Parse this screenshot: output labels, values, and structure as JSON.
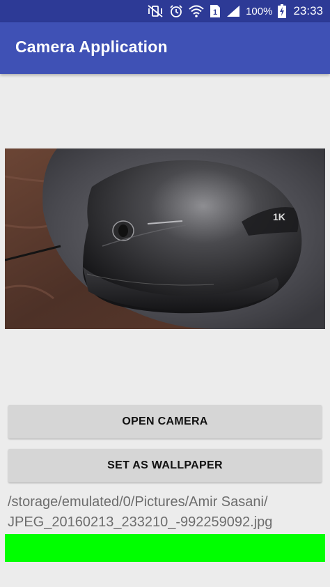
{
  "status_bar": {
    "battery_percent": "100%",
    "time": "23:33",
    "sim_slot": "1",
    "icons": [
      "mute-vibrate-icon",
      "alarm-icon",
      "wifi-icon",
      "sim-icon",
      "signal-icon",
      "battery-charging-icon"
    ]
  },
  "app_bar": {
    "title": "Camera Application",
    "color": "#3f51b5",
    "status_color": "#2d3a96"
  },
  "image": {
    "description_name": "captured-photo-mouse",
    "logo_text": "1K"
  },
  "buttons": {
    "open_camera": "OPEN CAMERA",
    "set_wallpaper": "SET AS WALLPAPER"
  },
  "file_path": {
    "line1": "/storage/emulated/0/Pictures/Amir Sasani/",
    "line2": "JPEG_20160213_233210_-992259092.jpg"
  },
  "status_indicator": {
    "color": "#00ff00"
  }
}
